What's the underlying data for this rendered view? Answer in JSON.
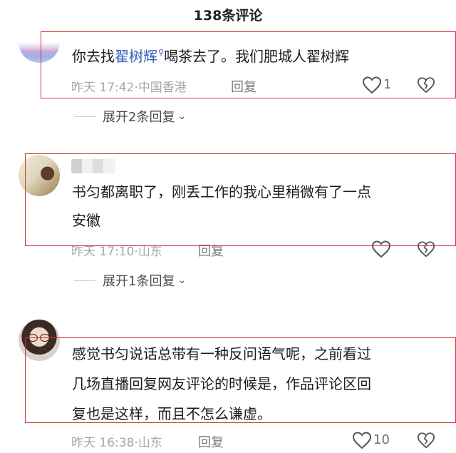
{
  "header": {
    "title": "138条评论"
  },
  "comments": [
    {
      "mention": "翟树辉",
      "text_before": "你去找",
      "text_after": "喝茶去了。我们肥城人翟树辉",
      "time": "昨天 17:42",
      "location": "中国香港",
      "reply_label": "回复",
      "likes": "1",
      "expand_label": "展开2条回复"
    },
    {
      "username": "",
      "text_line1": "书匀都离职了，刚丢工作的我心里稍微有了一点",
      "text_line2": "安徽",
      "time": "昨天 17:10",
      "location": "山东",
      "reply_label": "回复",
      "likes": "",
      "expand_label": "展开1条回复"
    },
    {
      "text_line1": "感觉书匀说话总带有一种反问语气呢，之前看过",
      "text_line2": "几场直播回复网友评论的时候是，作品评论区回",
      "text_line3": "复也是这样，而且不怎么谦虚。",
      "time": "昨天 16:38",
      "location": "山东",
      "reply_label": "回复",
      "likes": "10"
    }
  ],
  "separator": "·",
  "icons": {
    "like": "heart-outline-icon",
    "dislike": "broken-heart-icon",
    "expand": "chevron-down-icon",
    "mention": "search-icon"
  },
  "colors": {
    "mention": "#2f5fb8",
    "highlight_box": "#d23333",
    "meta": "#a7a7a7"
  }
}
